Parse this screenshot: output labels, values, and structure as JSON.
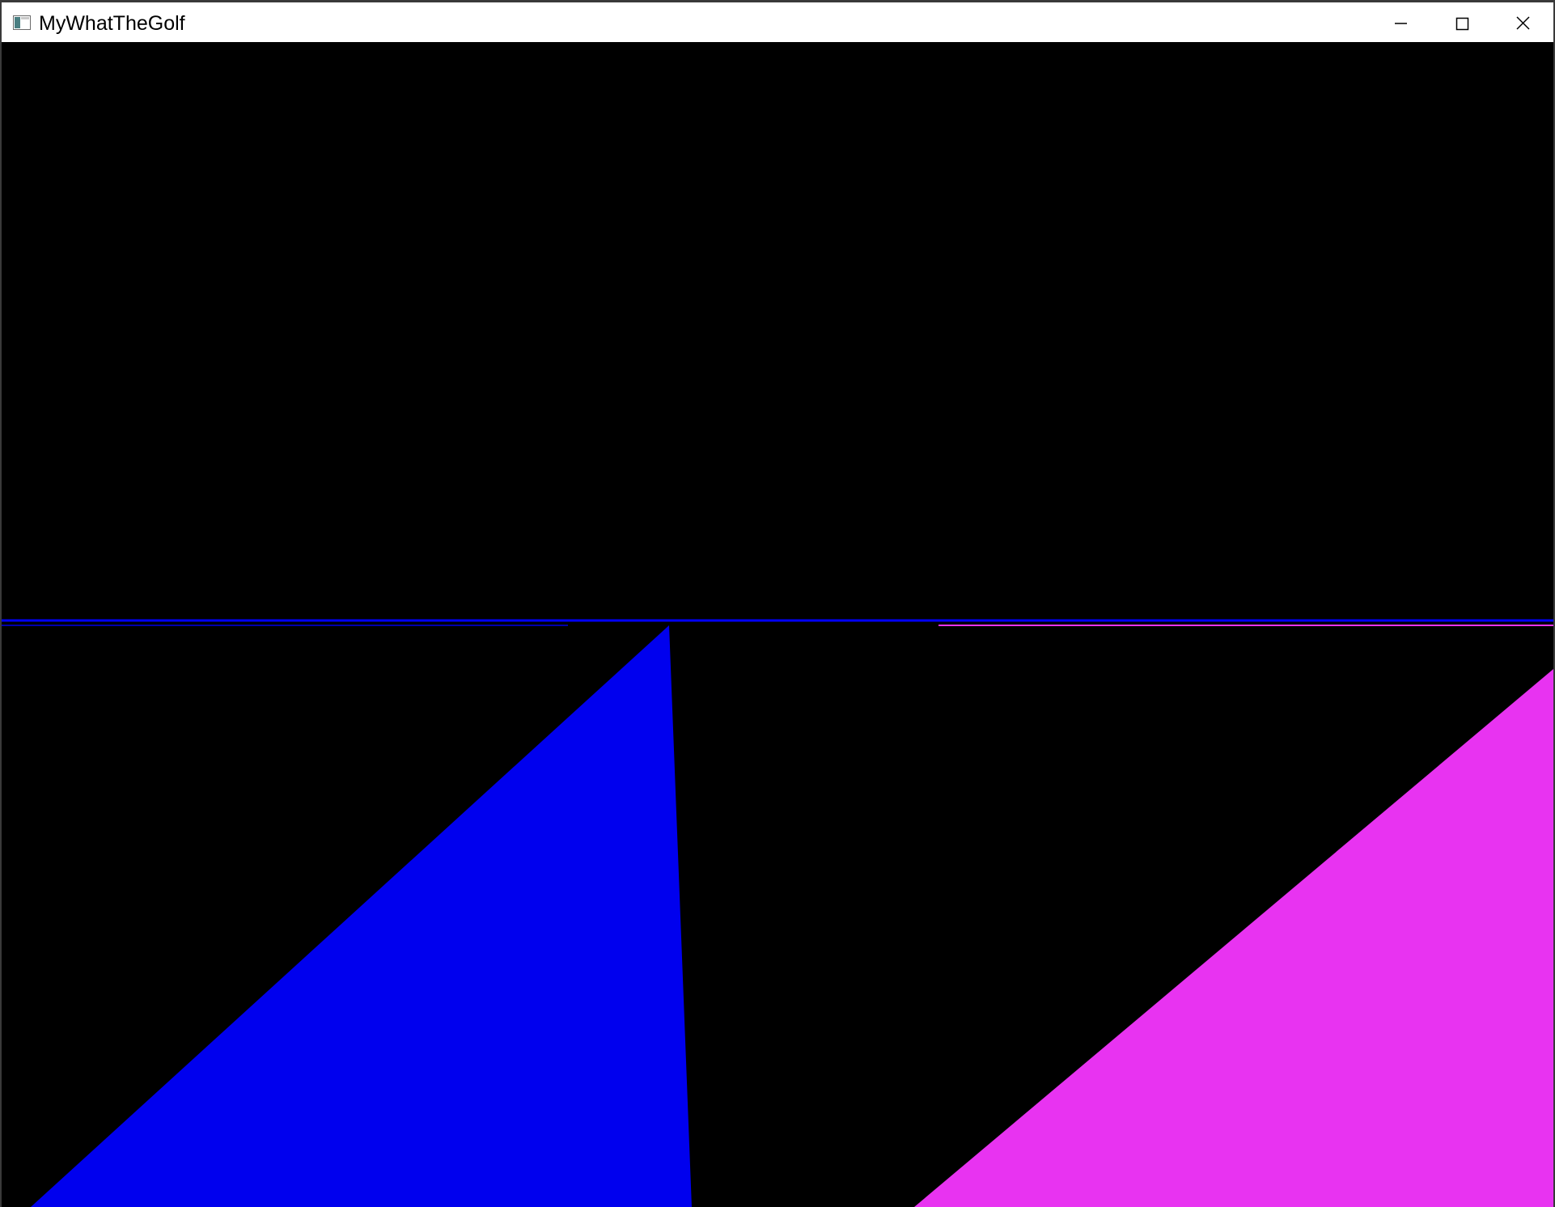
{
  "window": {
    "title": "MyWhatTheGolf",
    "app_icon": "window-app-icon",
    "controls": {
      "minimize_icon": "minimize-icon",
      "maximize_icon": "maximize-icon",
      "close_icon": "close-icon"
    }
  },
  "scene": {
    "background_color": "#000000",
    "ground_line_color": "#0000ff",
    "shapes": [
      {
        "name": "blue-triangle",
        "color": "#0000ee"
      },
      {
        "name": "magenta-triangle",
        "color": "#e833f1"
      }
    ],
    "ground_accent_color": "#e833f1"
  }
}
